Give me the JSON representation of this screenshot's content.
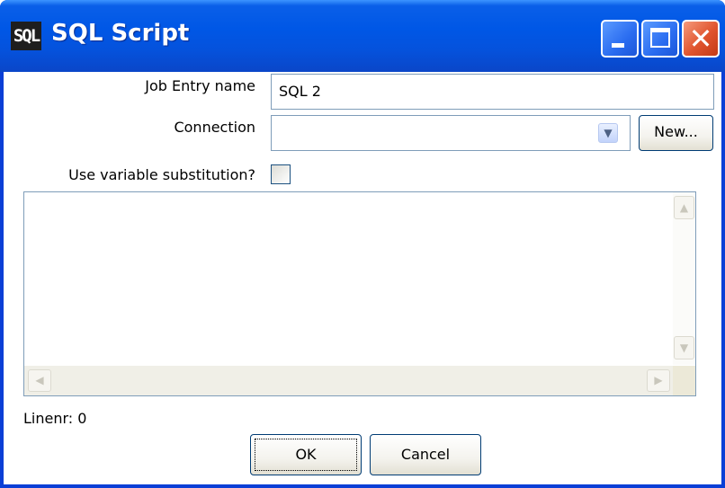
{
  "window": {
    "title": "SQL Script",
    "icon_text": "SQL",
    "controls": {
      "minimize": "minimize-icon",
      "maximize": "maximize-icon",
      "close": "close-icon"
    }
  },
  "form": {
    "job_entry_label": "Job Entry name",
    "job_entry_value": "SQL 2",
    "connection_label": "Connection",
    "connection_value": "",
    "new_button": "New...",
    "variable_label": "Use variable substitution?",
    "variable_checked": false
  },
  "editor": {
    "content": ""
  },
  "status": {
    "linenr": "Linenr: 0"
  },
  "buttons": {
    "ok": "OK",
    "cancel": "Cancel"
  },
  "colors": {
    "titlebar": "#0055e5",
    "close": "#e0542e",
    "border": "#7f9db9"
  }
}
